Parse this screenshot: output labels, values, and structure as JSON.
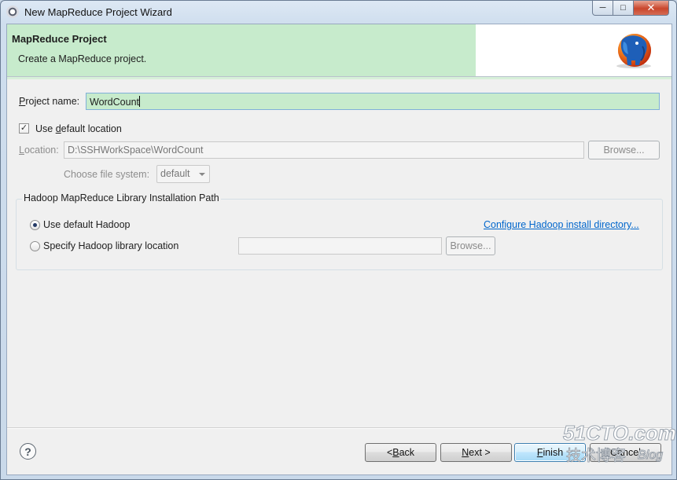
{
  "window": {
    "title": "New MapReduce Project Wizard",
    "controls": {
      "minimize": "─",
      "maximize": "□",
      "close": "✕"
    }
  },
  "banner": {
    "title": "MapReduce Project",
    "description": "Create a MapReduce project.",
    "logo_icon": "hadoop-elephant-logo"
  },
  "form": {
    "project_name_label_pre": "P",
    "project_name_label_post": "roject name:",
    "project_name_value": "WordCount",
    "use_default_location_pre": "Use ",
    "use_default_location_ul": "d",
    "use_default_location_post": "efault location",
    "use_default_location_checked": true,
    "location_label_ul": "L",
    "location_label_post": "ocation:",
    "location_value": "D:\\SSHWorkSpace\\WordCount",
    "location_browse_label": "Browse...",
    "file_system_label": "Choose file system:",
    "file_system_value": "default"
  },
  "hadoop_group": {
    "title": "Hadoop MapReduce Library Installation Path",
    "option_default": "Use default Hadoop",
    "option_default_selected": true,
    "option_specify": "Specify Hadoop library location",
    "configure_link": "Configure Hadoop install directory...",
    "library_path_value": "",
    "library_browse_label": "Browse..."
  },
  "footer": {
    "help_icon": "?",
    "back_pre": "< ",
    "back_ul": "B",
    "back_post": "ack",
    "next_ul": "N",
    "next_post": "ext >",
    "finish_ul": "F",
    "finish_post": "inish",
    "cancel_label": "Cancel"
  },
  "watermark": {
    "line1": "51CTO.com",
    "line2": "技术博客",
    "line3": "Blog"
  },
  "colors": {
    "banner_green": "#c7ebcc",
    "link_blue": "#0066cc",
    "title_bar": "#cfdeee"
  }
}
